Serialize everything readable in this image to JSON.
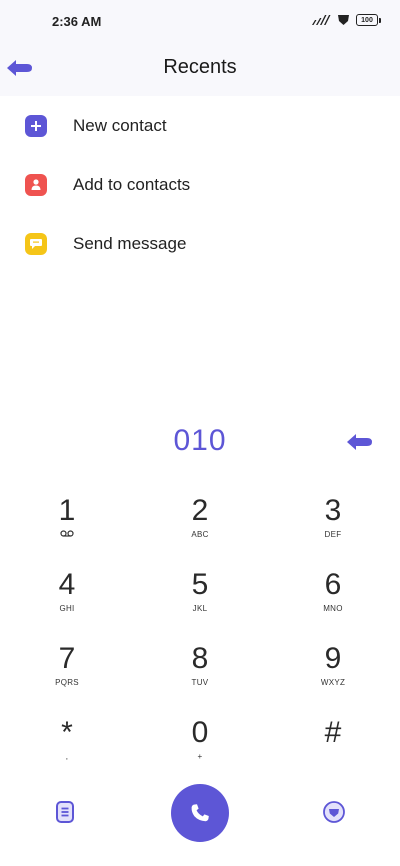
{
  "status_bar": {
    "time": "2:36 AM",
    "battery": "100"
  },
  "header": {
    "title": "Recents",
    "back_icon": "back-arrow-icon"
  },
  "actions": [
    {
      "label": "New contact",
      "icon": "plus-icon",
      "color": "#5d56d6"
    },
    {
      "label": "Add to contacts",
      "icon": "person-icon",
      "color": "#ef5350"
    },
    {
      "label": "Send message",
      "icon": "message-icon",
      "color": "#f5c518"
    }
  ],
  "dialer": {
    "number": "010",
    "keys": [
      {
        "digit": "1",
        "letters": ""
      },
      {
        "digit": "2",
        "letters": "ABC"
      },
      {
        "digit": "3",
        "letters": "DEF"
      },
      {
        "digit": "4",
        "letters": "GHI"
      },
      {
        "digit": "5",
        "letters": "JKL"
      },
      {
        "digit": "6",
        "letters": "MNO"
      },
      {
        "digit": "7",
        "letters": "PQRS"
      },
      {
        "digit": "8",
        "letters": "TUV"
      },
      {
        "digit": "9",
        "letters": "WXYZ"
      },
      {
        "digit": "*",
        "letters": ","
      },
      {
        "digit": "0",
        "letters": "+"
      },
      {
        "digit": "#",
        "letters": ""
      }
    ]
  },
  "colors": {
    "accent": "#5d56d6",
    "add_contact": "#ef5350",
    "message": "#f5c518"
  }
}
